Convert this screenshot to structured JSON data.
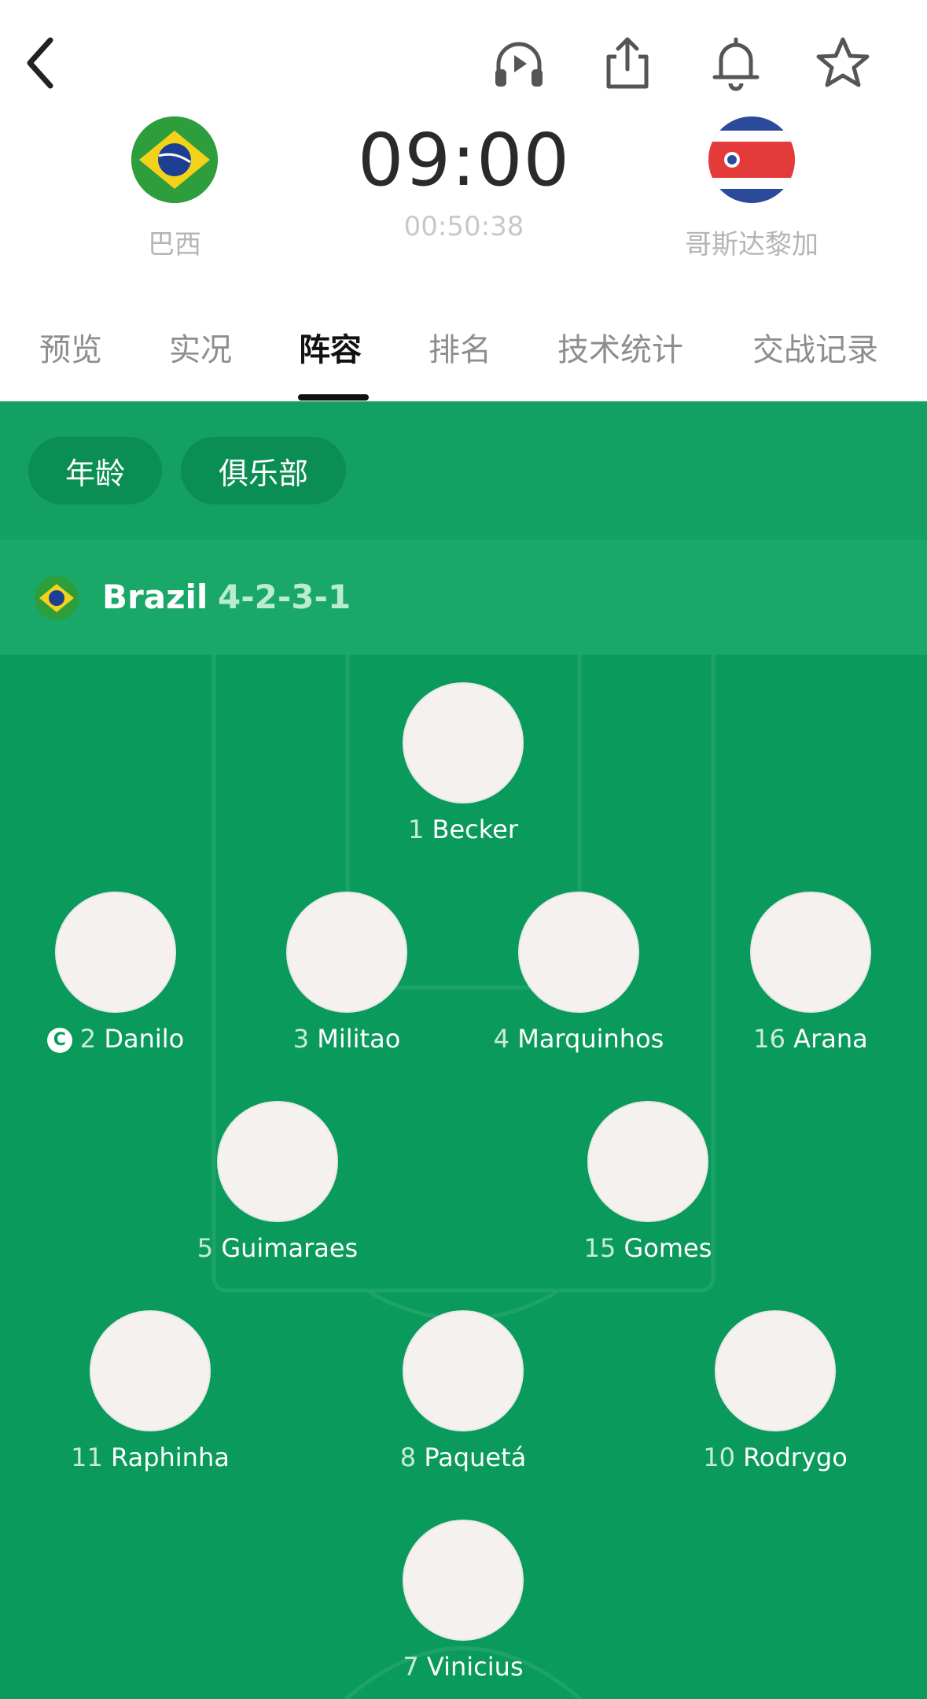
{
  "header": {
    "home_team": "巴西",
    "away_team": "哥斯达黎加",
    "time": "09:00",
    "countdown": "00:50:38",
    "icons": [
      "back-icon",
      "headphones-icon",
      "share-icon",
      "bell-icon",
      "star-icon"
    ]
  },
  "tabs": [
    "预览",
    "实况",
    "阵容",
    "排名",
    "技术统计",
    "交战记录"
  ],
  "active_tab": "阵容",
  "filters": [
    "年龄",
    "俱乐部"
  ],
  "lineup": {
    "team": "Brazil",
    "formation": "4-2-3-1",
    "players": [
      {
        "num": "1",
        "name": "Becker",
        "captain": false
      },
      {
        "num": "2",
        "name": "Danilo",
        "captain": true
      },
      {
        "num": "3",
        "name": "Militao",
        "captain": false
      },
      {
        "num": "4",
        "name": "Marquinhos",
        "captain": false
      },
      {
        "num": "16",
        "name": "Arana",
        "captain": false
      },
      {
        "num": "5",
        "name": "Guimaraes",
        "captain": false
      },
      {
        "num": "15",
        "name": "Gomes",
        "captain": false
      },
      {
        "num": "11",
        "name": "Raphinha",
        "captain": false
      },
      {
        "num": "8",
        "name": "Paquetá",
        "captain": false
      },
      {
        "num": "10",
        "name": "Rodrygo",
        "captain": false
      },
      {
        "num": "7",
        "name": "Vinicius",
        "captain": false
      }
    ],
    "captain_mark": "C"
  },
  "colors": {
    "pitch": "#0a9a5c",
    "brazil_green": "#2e9e3c",
    "brazil_yellow": "#f4d21a",
    "brazil_blue": "#1c3f94",
    "costa_rica_red": "#e53a3a",
    "costa_rica_blue": "#2c4a9c"
  }
}
